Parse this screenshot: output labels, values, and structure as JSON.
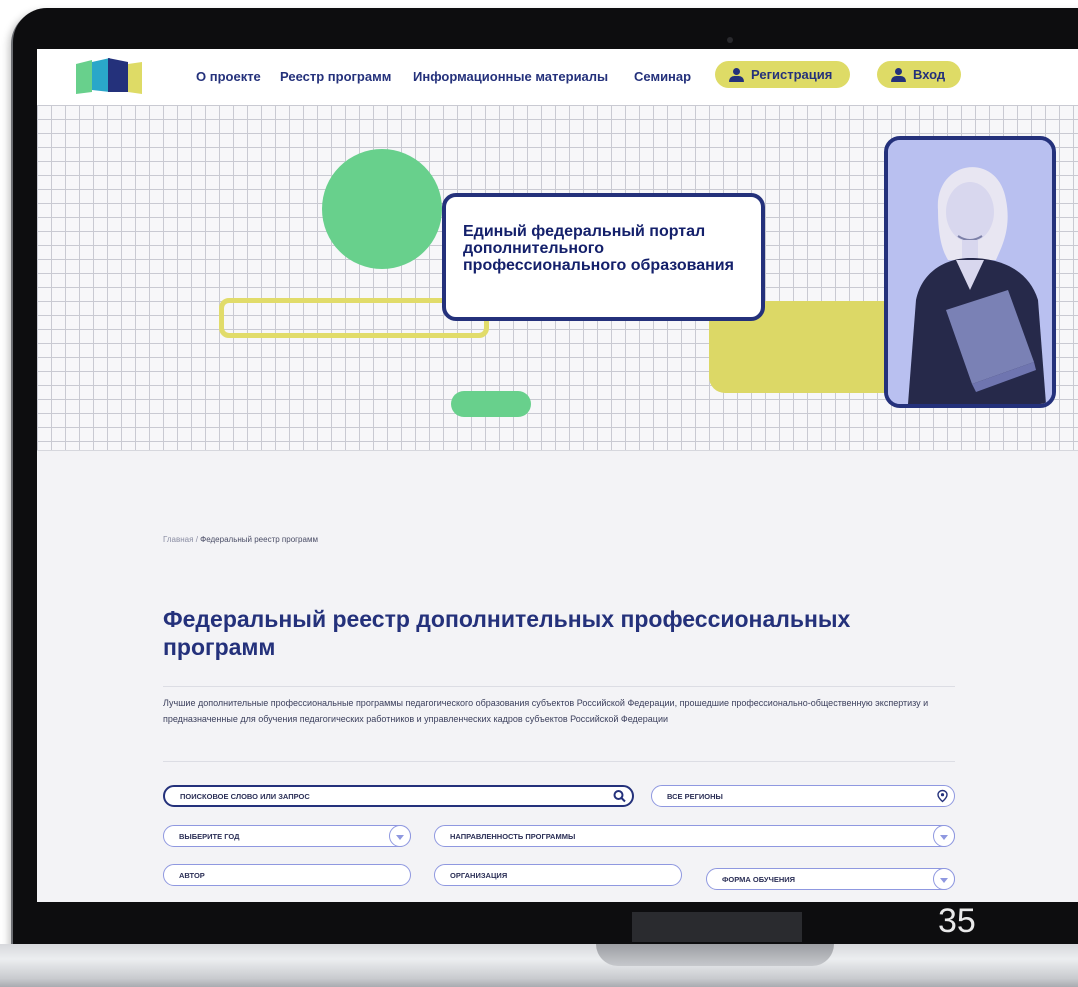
{
  "nav": {
    "about": "О проекте",
    "registry": "Реестр программ",
    "materials": "Информационные материалы",
    "seminar": "Семинар",
    "register": "Регистрация",
    "login": "Вход"
  },
  "hero": {
    "title": "Единый федеральный портал дополнительного профессионального образования"
  },
  "breadcrumb": {
    "home": "Главная",
    "separator": "/",
    "current": "Федеральный реестр программ"
  },
  "page": {
    "title": "Федеральный реестр дополнительных профессиональных программ",
    "description": "Лучшие дополнительные профессиональные программы педагогического образования субъектов Российской Федерации, прошедшие профессионально-общественную экспертизу и предназначенные для обучения педагогических работников и управленческих кадров субъектов Российской Федерации"
  },
  "filters": {
    "search_placeholder": "ПОИСКОВОЕ СЛОВО ИЛИ ЗАПРОС",
    "regions": "ВСЕ РЕГИОНЫ",
    "year": "ВЫБЕРИТЕ ГОД",
    "direction": "НАПРАВЛЕННОСТЬ ПРОГРАММЫ",
    "author": "АВТОР",
    "organization": "ОРГАНИЗАЦИЯ",
    "study_form": "ФОРМА ОБУЧЕНИЯ"
  },
  "slide": {
    "page_number": "35"
  },
  "colors": {
    "brand_navy": "#24317b",
    "accent_yellow": "#dedb66",
    "accent_green": "#68d08c",
    "field_border": "#8f98e0"
  },
  "icons": {
    "search": "search-icon",
    "location": "location-pin-icon",
    "user": "user-icon",
    "dropdown": "chevron-down-icon"
  }
}
